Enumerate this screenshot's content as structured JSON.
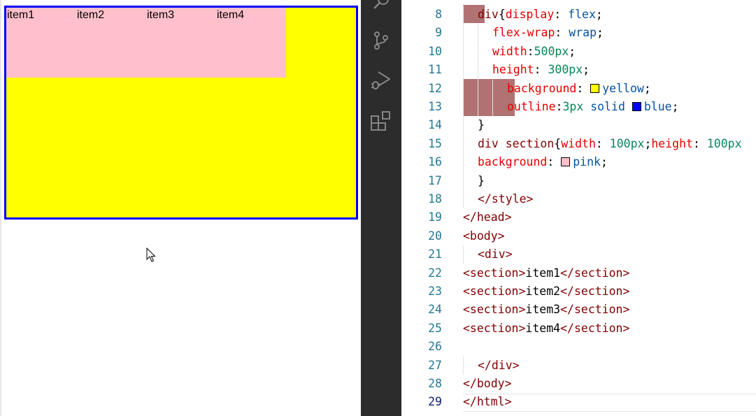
{
  "preview": {
    "items": [
      "item1",
      "item2",
      "item3",
      "item4"
    ],
    "colors": {
      "container_bg": "#ffff00",
      "container_outline": "#0000ff",
      "item_bg": "#ffc0cb"
    }
  },
  "activity_bar": {
    "icons": [
      "search-icon",
      "source-control-icon",
      "run-debug-icon",
      "extensions-icon"
    ]
  },
  "editor": {
    "current_line": 29,
    "lines": [
      {
        "n": "8",
        "indent": 1,
        "tokens": [
          [
            "sel",
            "div"
          ],
          [
            "punc",
            "{"
          ],
          [
            "prop",
            "display"
          ],
          [
            "punc",
            ": "
          ],
          [
            "val",
            "flex"
          ],
          [
            "punc",
            ";"
          ]
        ]
      },
      {
        "n": "9",
        "indent": 2,
        "tokens": [
          [
            "prop",
            "flex-wrap"
          ],
          [
            "punc",
            ": "
          ],
          [
            "val",
            "wrap"
          ],
          [
            "punc",
            ";"
          ]
        ]
      },
      {
        "n": "10",
        "indent": 2,
        "tokens": [
          [
            "prop",
            "width"
          ],
          [
            "punc",
            ":"
          ],
          [
            "num",
            "500px"
          ],
          [
            "punc",
            ";"
          ]
        ]
      },
      {
        "n": "11",
        "indent": 2,
        "tokens": [
          [
            "prop",
            "height"
          ],
          [
            "punc",
            ": "
          ],
          [
            "num",
            "300px"
          ],
          [
            "punc",
            ";"
          ]
        ]
      },
      {
        "n": "12",
        "indent": 3,
        "tokens": [
          [
            "prop",
            "background"
          ],
          [
            "punc",
            ": "
          ],
          [
            "swatch",
            "#ffff00"
          ],
          [
            "val",
            "yellow"
          ],
          [
            "punc",
            ";"
          ]
        ]
      },
      {
        "n": "13",
        "indent": 3,
        "tokens": [
          [
            "prop",
            "outline"
          ],
          [
            "punc",
            ":"
          ],
          [
            "num",
            "3px"
          ],
          [
            "punc",
            " "
          ],
          [
            "val",
            "solid"
          ],
          [
            "punc",
            " "
          ],
          [
            "swatch",
            "#0000ff"
          ],
          [
            "val",
            "blue"
          ],
          [
            "punc",
            ";"
          ]
        ]
      },
      {
        "n": "14",
        "indent": 1,
        "tokens": [
          [
            "punc",
            "}"
          ]
        ]
      },
      {
        "n": "15",
        "indent": 1,
        "tokens": [
          [
            "sel",
            "div section"
          ],
          [
            "punc",
            "{"
          ],
          [
            "prop",
            "width"
          ],
          [
            "punc",
            ": "
          ],
          [
            "num",
            "100px"
          ],
          [
            "punc",
            ";"
          ],
          [
            "prop",
            "height"
          ],
          [
            "punc",
            ": "
          ],
          [
            "num",
            "100px"
          ]
        ]
      },
      {
        "n": "16",
        "indent": 1,
        "tokens": [
          [
            "prop",
            "background"
          ],
          [
            "punc",
            ": "
          ],
          [
            "swatch",
            "#ffc0cb"
          ],
          [
            "val",
            "pink"
          ],
          [
            "punc",
            ";"
          ]
        ]
      },
      {
        "n": "17",
        "indent": 1,
        "tokens": [
          [
            "punc",
            "}"
          ]
        ]
      },
      {
        "n": "18",
        "indent": 1,
        "tokens": [
          [
            "tag",
            "</style>"
          ]
        ]
      },
      {
        "n": "19",
        "indent": 0,
        "tokens": [
          [
            "tag",
            "</head>"
          ]
        ]
      },
      {
        "n": "20",
        "indent": 0,
        "tokens": [
          [
            "tag",
            "<body>"
          ]
        ]
      },
      {
        "n": "21",
        "indent": 1,
        "tokens": [
          [
            "tag",
            "<div>"
          ]
        ]
      },
      {
        "n": "22",
        "indent": 0,
        "tokens": [
          [
            "tag",
            "<section>"
          ],
          [
            "text",
            "item1"
          ],
          [
            "tag",
            "</section>"
          ]
        ]
      },
      {
        "n": "23",
        "indent": 0,
        "tokens": [
          [
            "tag",
            "<section>"
          ],
          [
            "text",
            "item2"
          ],
          [
            "tag",
            "</section>"
          ]
        ]
      },
      {
        "n": "24",
        "indent": 0,
        "tokens": [
          [
            "tag",
            "<section>"
          ],
          [
            "text",
            "item3"
          ],
          [
            "tag",
            "</section>"
          ]
        ]
      },
      {
        "n": "25",
        "indent": 0,
        "tokens": [
          [
            "tag",
            "<section>"
          ],
          [
            "text",
            "item4"
          ],
          [
            "tag",
            "</section>"
          ]
        ]
      },
      {
        "n": "26",
        "indent": 0,
        "tokens": []
      },
      {
        "n": "27",
        "indent": 1,
        "tokens": [
          [
            "tag",
            "</div>"
          ]
        ]
      },
      {
        "n": "28",
        "indent": 0,
        "tokens": [
          [
            "tag",
            "</body>"
          ]
        ]
      },
      {
        "n": "29",
        "indent": 0,
        "tokens": [
          [
            "tag",
            "</html>"
          ]
        ]
      }
    ]
  }
}
